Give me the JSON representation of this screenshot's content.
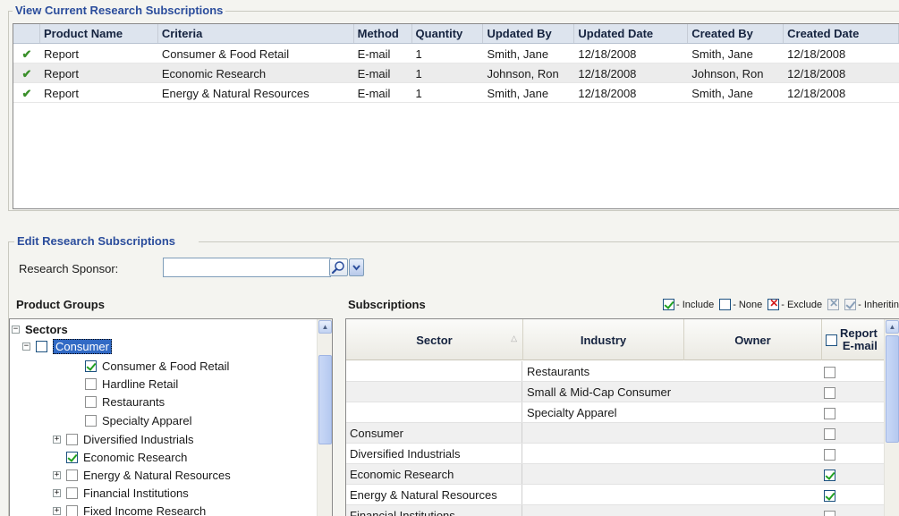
{
  "view_section": {
    "title": "View Current Research Subscriptions",
    "columns": [
      "",
      "Product Name",
      "Criteria",
      "Method",
      "Quantity",
      "Updated By",
      "Updated Date",
      "Created By",
      "Created Date"
    ],
    "rows": [
      {
        "status": "✔",
        "product": "Report",
        "criteria": "Consumer & Food Retail",
        "method": "E-mail",
        "quantity": "1",
        "updated_by": "Smith, Jane",
        "updated_date": "12/18/2008",
        "created_by": "Smith, Jane",
        "created_date": "12/18/2008"
      },
      {
        "status": "✔",
        "product": "Report",
        "criteria": "Economic Research",
        "method": "E-mail",
        "quantity": "1",
        "updated_by": "Johnson, Ron",
        "updated_date": "12/18/2008",
        "created_by": "Johnson, Ron",
        "created_date": "12/18/2008"
      },
      {
        "status": "✔",
        "product": "Report",
        "criteria": "Energy & Natural Resources",
        "method": "E-mail",
        "quantity": "1",
        "updated_by": "Smith, Jane",
        "updated_date": "12/18/2008",
        "created_by": "Smith, Jane",
        "created_date": "12/18/2008"
      }
    ]
  },
  "edit_section": {
    "title": "Edit Research Subscriptions",
    "sponsor_label": "Research Sponsor:",
    "sponsor_value": "",
    "search_icon": "magnifier-icon",
    "dropdown_icon": "chevron-down-icon"
  },
  "product_groups": {
    "label": "Product Groups",
    "items": [
      {
        "label": "Sectors",
        "expander": "⊟",
        "checkbox": "none"
      },
      {
        "label": "Consumer",
        "expander": "⊟",
        "checkbox": "none",
        "selected": true
      },
      {
        "label": "Consumer & Food Retail",
        "checkbox": "checked"
      },
      {
        "label": "Hardline Retail",
        "checkbox": "none"
      },
      {
        "label": "Restaurants",
        "checkbox": "none"
      },
      {
        "label": "Specialty Apparel",
        "checkbox": "none"
      },
      {
        "label": "Diversified Industrials",
        "expander": "⊞",
        "checkbox": "none"
      },
      {
        "label": "Economic Research",
        "checkbox": "checked"
      },
      {
        "label": "Energy & Natural Resources",
        "expander": "⊞",
        "checkbox": "none"
      },
      {
        "label": "Financial Institutions",
        "expander": "⊞",
        "checkbox": "none"
      },
      {
        "label": "Fixed Income Research",
        "expander": "⊞",
        "checkbox": "none"
      }
    ]
  },
  "subscriptions": {
    "label": "Subscriptions",
    "legend": {
      "include": "- Include",
      "none": "- None",
      "exclude": "- Exclude",
      "inheriting": "- Inheritin"
    },
    "columns": {
      "sector": "Sector",
      "industry": "Industry",
      "owner": "Owner",
      "report_email_line1": "Report",
      "report_email_line2": "E-mail"
    },
    "rows": [
      {
        "sector": "",
        "industry": "Restaurants",
        "owner": "",
        "report_email": "none"
      },
      {
        "sector": "",
        "industry": "Small & Mid-Cap Consumer",
        "owner": "",
        "report_email": "none"
      },
      {
        "sector": "",
        "industry": "Specialty Apparel",
        "owner": "",
        "report_email": "none"
      },
      {
        "sector": "Consumer",
        "industry": "",
        "owner": "",
        "report_email": "none"
      },
      {
        "sector": "Diversified Industrials",
        "industry": "",
        "owner": "",
        "report_email": "none"
      },
      {
        "sector": "Economic Research",
        "industry": "",
        "owner": "",
        "report_email": "checked"
      },
      {
        "sector": "Energy & Natural Resources",
        "industry": "",
        "owner": "",
        "report_email": "checked"
      },
      {
        "sector": "Financial Institutions",
        "industry": "",
        "owner": "",
        "report_email": "none"
      }
    ]
  }
}
